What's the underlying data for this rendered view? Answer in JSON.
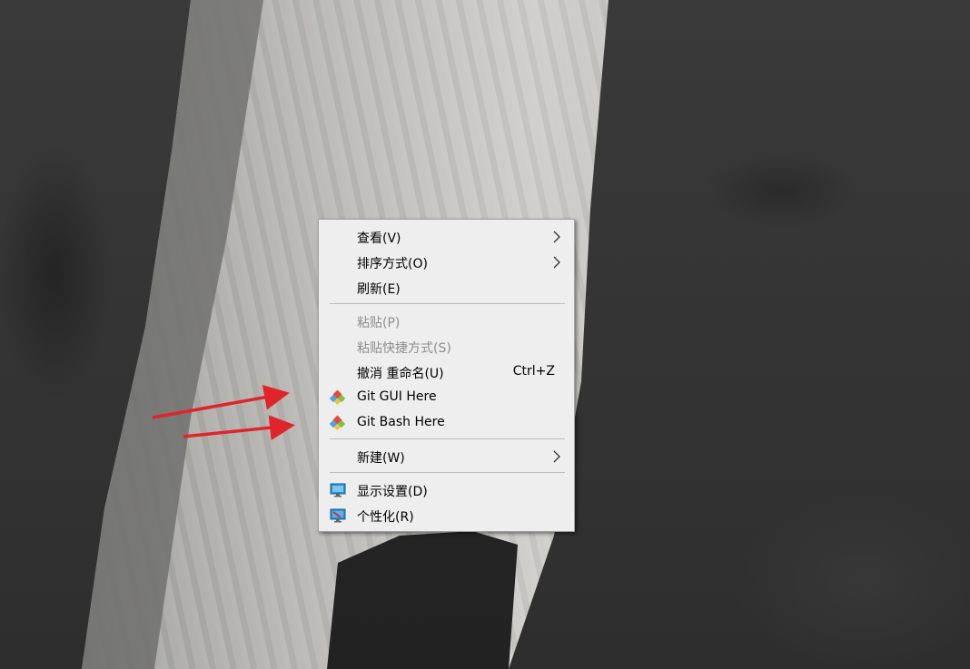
{
  "context_menu": {
    "items": [
      {
        "label": "查看(V)",
        "shortcut": "",
        "submenu": true,
        "disabled": false,
        "icon": ""
      },
      {
        "label": "排序方式(O)",
        "shortcut": "",
        "submenu": true,
        "disabled": false,
        "icon": ""
      },
      {
        "label": "刷新(E)",
        "shortcut": "",
        "submenu": false,
        "disabled": false,
        "icon": ""
      },
      {
        "label": "粘贴(P)",
        "shortcut": "",
        "submenu": false,
        "disabled": true,
        "icon": ""
      },
      {
        "label": "粘贴快捷方式(S)",
        "shortcut": "",
        "submenu": false,
        "disabled": true,
        "icon": ""
      },
      {
        "label": "撤消 重命名(U)",
        "shortcut": "Ctrl+Z",
        "submenu": false,
        "disabled": false,
        "icon": ""
      },
      {
        "label": "Git GUI Here",
        "shortcut": "",
        "submenu": false,
        "disabled": false,
        "icon": "git-diamond-icon"
      },
      {
        "label": "Git Bash Here",
        "shortcut": "",
        "submenu": false,
        "disabled": false,
        "icon": "git-diamond-icon"
      },
      {
        "label": "新建(W)",
        "shortcut": "",
        "submenu": true,
        "disabled": false,
        "icon": ""
      },
      {
        "label": "显示设置(D)",
        "shortcut": "",
        "submenu": false,
        "disabled": false,
        "icon": "display-monitor-icon"
      },
      {
        "label": "个性化(R)",
        "shortcut": "",
        "submenu": false,
        "disabled": false,
        "icon": "personalize-monitor-icon"
      }
    ]
  },
  "colors": {
    "menu_background": "#eeeeee",
    "disabled_text": "#8d8d8d",
    "annotation_arrow": "#e0242a"
  },
  "annotations": [
    "red-arrow-pointing-to-git-gui-here",
    "red-arrow-pointing-to-git-bash-here"
  ]
}
